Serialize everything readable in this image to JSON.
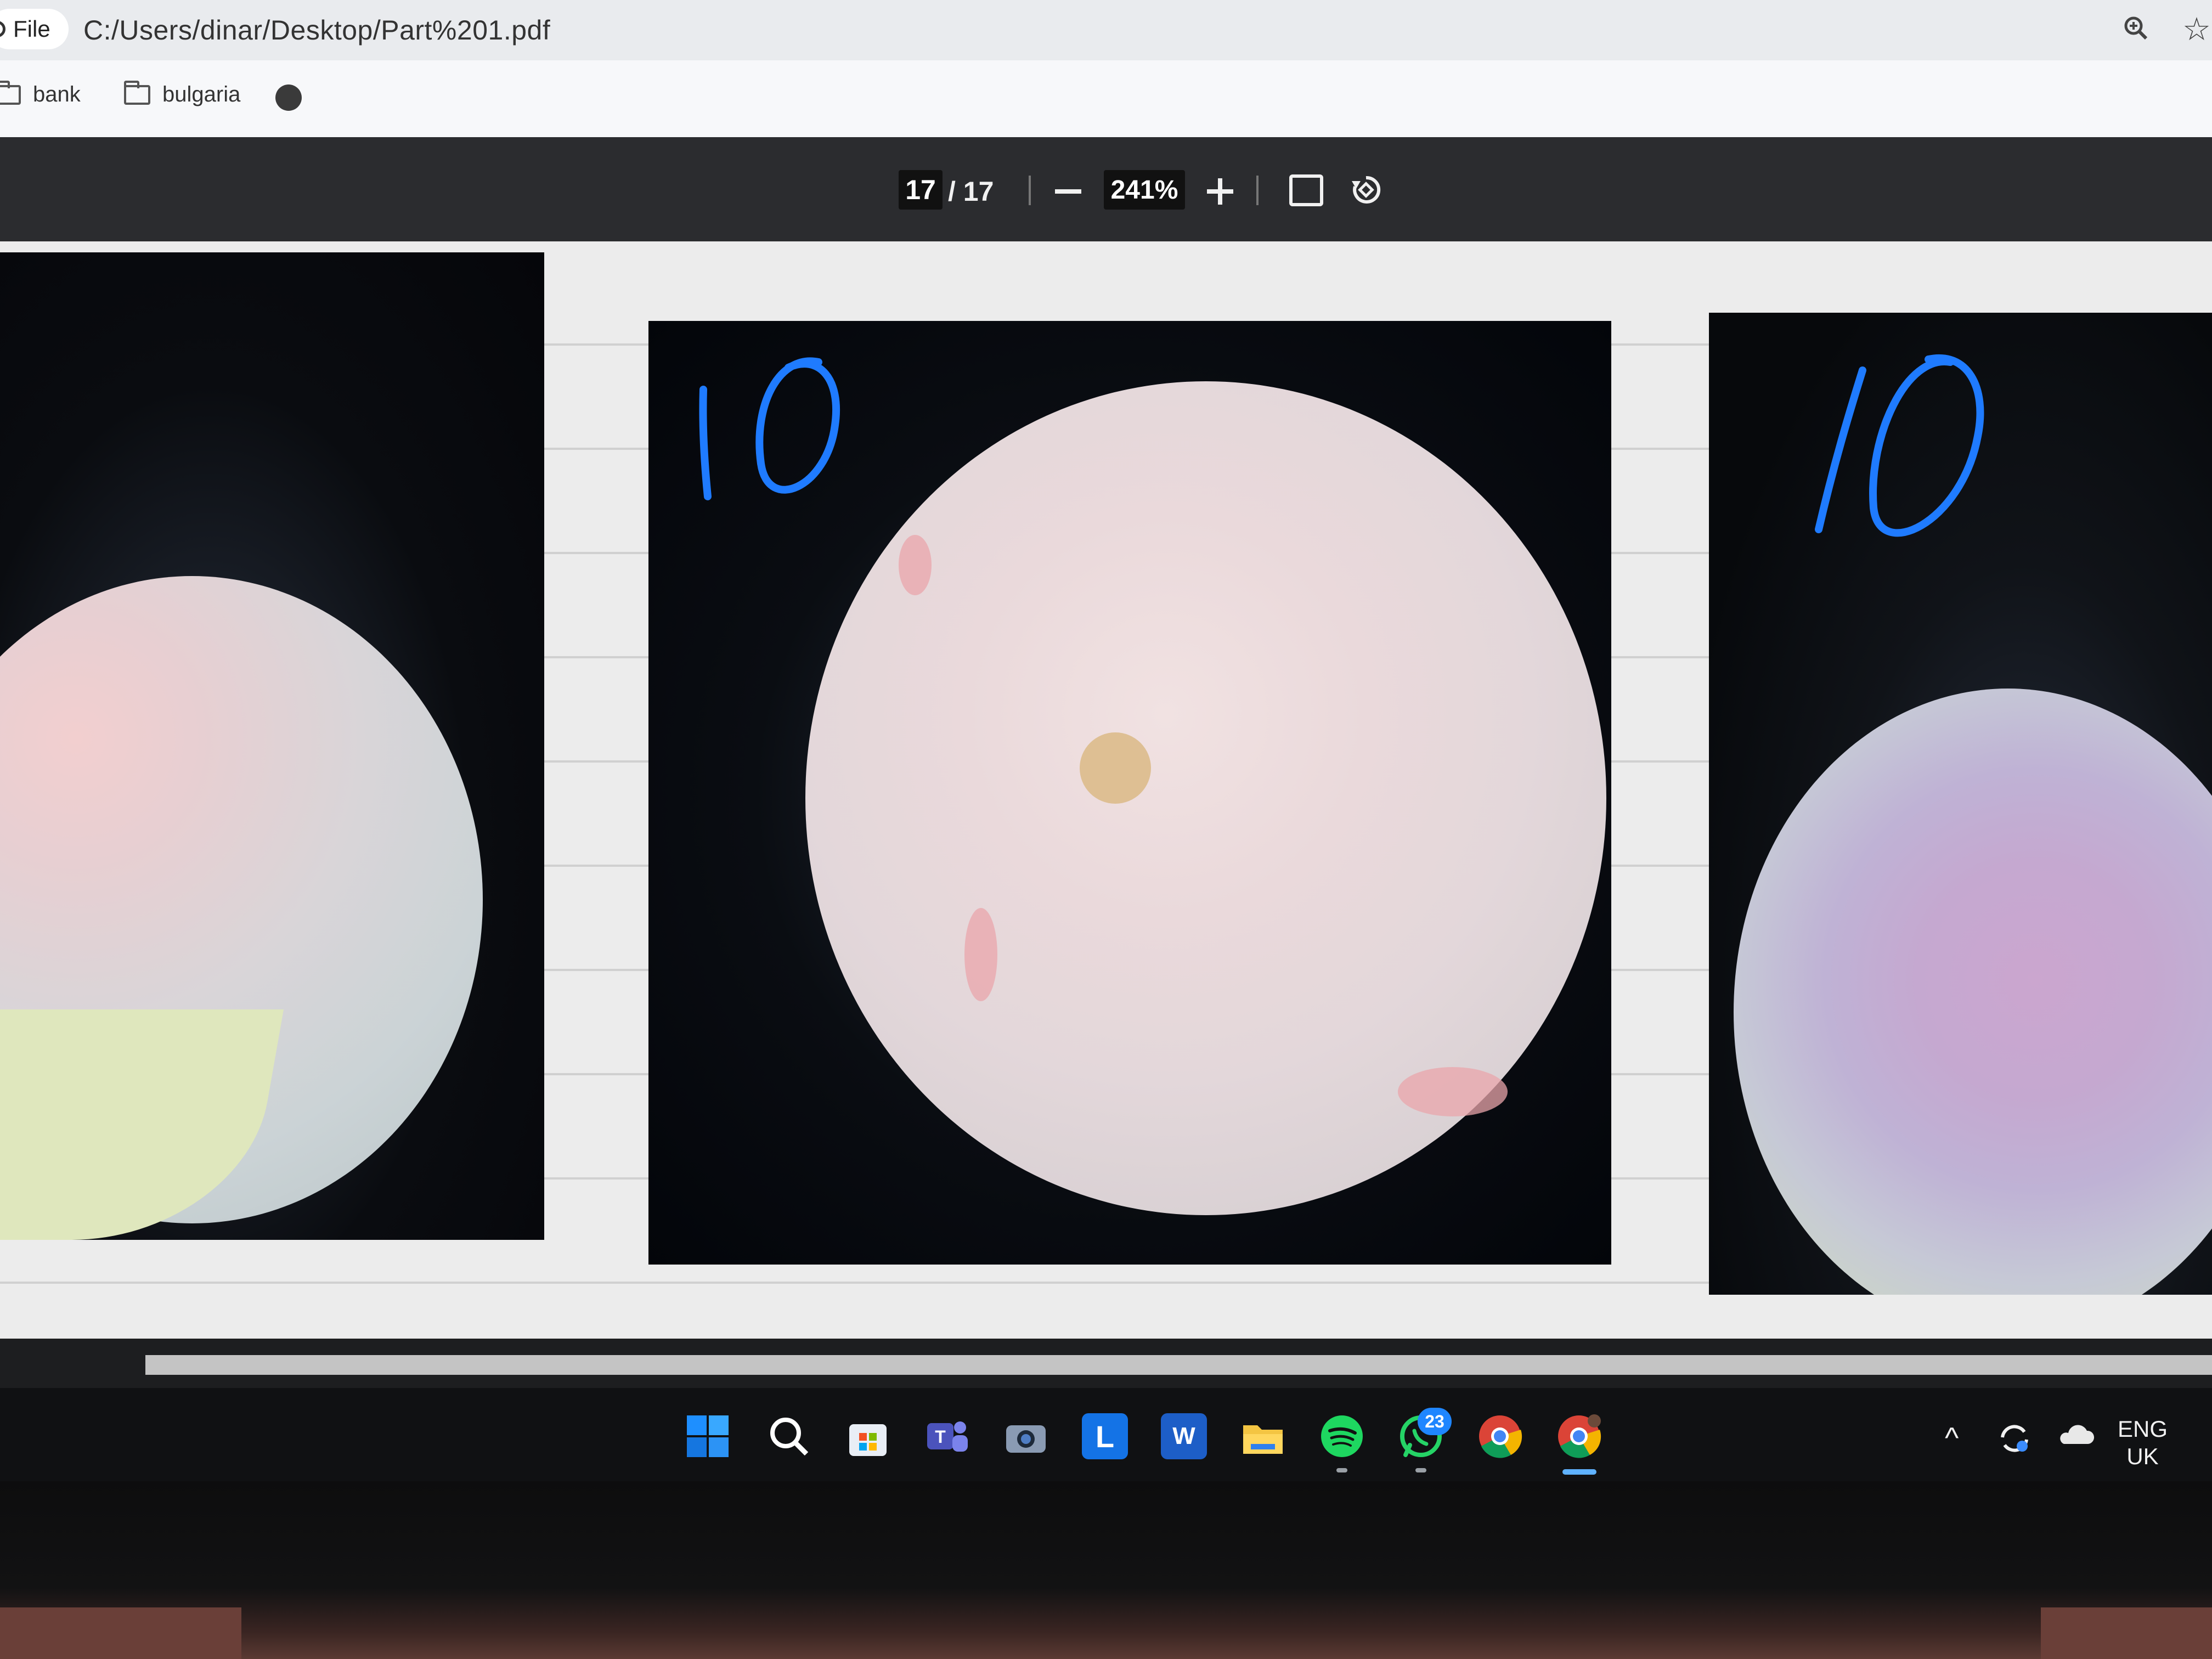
{
  "browser": {
    "file_chip_label": "File",
    "url": "C:/Users/dinar/Desktop/Part%201.pdf",
    "zoom_icon": "zoom-icon",
    "bookmark_star_icon": "star-icon"
  },
  "bookmarks": {
    "items": [
      {
        "label": "bank",
        "icon": "folder-icon"
      },
      {
        "label": "bulgaria",
        "icon": "folder-icon"
      }
    ],
    "extra_icon": "globe-icon"
  },
  "pdf_toolbar": {
    "current_page": "17",
    "total_pages": "/ 17",
    "zoom_level": "241%"
  },
  "pages": {
    "handwritten_labels": [
      "10",
      "10"
    ],
    "images": [
      "micrograph-left",
      "micrograph-middle",
      "micrograph-right"
    ]
  },
  "taskbar": {
    "apps": [
      {
        "name": "start-icon"
      },
      {
        "name": "search-icon"
      },
      {
        "name": "store-icon"
      },
      {
        "name": "teams-icon"
      },
      {
        "name": "camera-icon"
      },
      {
        "name": "l-app-icon",
        "glyph": "L"
      },
      {
        "name": "word-icon",
        "glyph": "W"
      },
      {
        "name": "file-explorer-icon"
      },
      {
        "name": "spotify-icon"
      },
      {
        "name": "whatsapp-icon",
        "badge": "23"
      },
      {
        "name": "chrome-icon"
      },
      {
        "name": "chrome-profile-icon"
      }
    ],
    "tray": {
      "chevron": "^",
      "lang_top": "ENG",
      "lang_bottom": "UK"
    }
  },
  "colors": {
    "accent_blue": "#1f86ff",
    "toolbar_dark": "#2b2c2f",
    "handwriting_blue": "#1f7bff"
  }
}
